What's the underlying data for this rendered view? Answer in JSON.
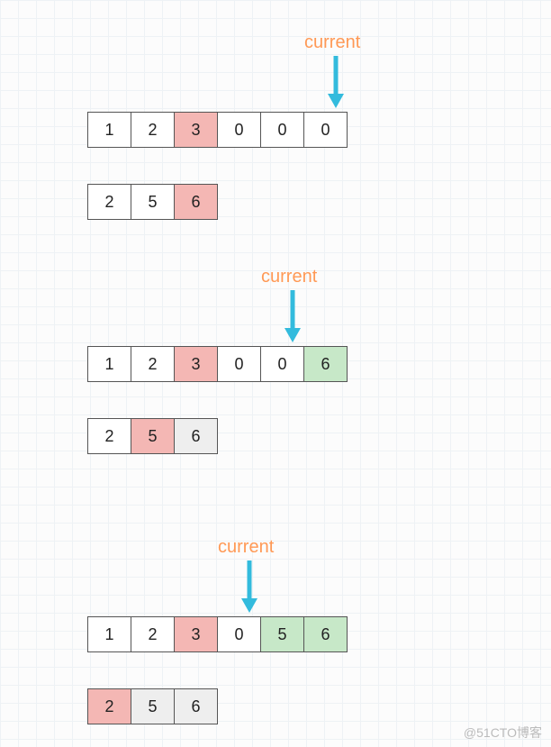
{
  "chart_data": [
    {
      "type": "table",
      "title": "current",
      "arrow_index": 5,
      "rows": [
        [
          {
            "v": "1",
            "c": "white"
          },
          {
            "v": "2",
            "c": "white"
          },
          {
            "v": "3",
            "c": "pink"
          },
          {
            "v": "0",
            "c": "white"
          },
          {
            "v": "0",
            "c": "white"
          },
          {
            "v": "0",
            "c": "white"
          }
        ],
        [
          {
            "v": "2",
            "c": "white"
          },
          {
            "v": "5",
            "c": "white"
          },
          {
            "v": "6",
            "c": "pink"
          }
        ]
      ]
    },
    {
      "type": "table",
      "title": "current",
      "arrow_index": 4,
      "rows": [
        [
          {
            "v": "1",
            "c": "white"
          },
          {
            "v": "2",
            "c": "white"
          },
          {
            "v": "3",
            "c": "pink"
          },
          {
            "v": "0",
            "c": "white"
          },
          {
            "v": "0",
            "c": "white"
          },
          {
            "v": "6",
            "c": "green"
          }
        ],
        [
          {
            "v": "2",
            "c": "white"
          },
          {
            "v": "5",
            "c": "pink"
          },
          {
            "v": "6",
            "c": "gray"
          }
        ]
      ]
    },
    {
      "type": "table",
      "title": "current",
      "arrow_index": 3,
      "rows": [
        [
          {
            "v": "1",
            "c": "white"
          },
          {
            "v": "2",
            "c": "white"
          },
          {
            "v": "3",
            "c": "pink"
          },
          {
            "v": "0",
            "c": "white"
          },
          {
            "v": "5",
            "c": "green"
          },
          {
            "v": "6",
            "c": "green"
          }
        ],
        [
          {
            "v": "2",
            "c": "pink"
          },
          {
            "v": "5",
            "c": "gray"
          },
          {
            "v": "6",
            "c": "gray"
          }
        ]
      ]
    }
  ],
  "watermark": "@51CTO博客"
}
